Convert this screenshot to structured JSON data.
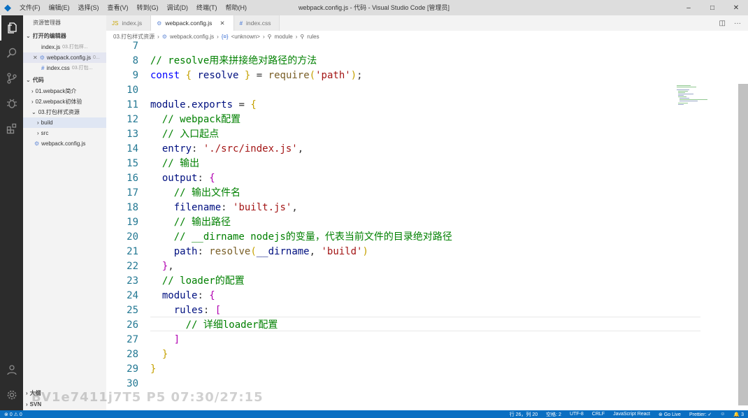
{
  "window": {
    "title": "webpack.config.js - 代码 - Visual Studio Code [管理员]",
    "menu": [
      "文件(F)",
      "编辑(E)",
      "选择(S)",
      "查看(V)",
      "转到(G)",
      "调试(D)",
      "终端(T)",
      "帮助(H)"
    ]
  },
  "sidebar": {
    "title": "资源管理器",
    "open_editors_label": "打开的编辑器",
    "open_editors": [
      {
        "name": "index.js",
        "path": "03.打包样..."
      },
      {
        "name": "webpack.config.js",
        "path": "0..."
      },
      {
        "name": "index.css",
        "path": "03.打包..."
      }
    ],
    "folder_label": "代码",
    "tree": [
      {
        "name": "01.webpack简介",
        "kind": "folder"
      },
      {
        "name": "02.webpack初体验",
        "kind": "folder"
      },
      {
        "name": "03.打包样式资源",
        "kind": "folder-open"
      },
      {
        "name": "build",
        "kind": "folder"
      },
      {
        "name": "src",
        "kind": "folder"
      },
      {
        "name": "webpack.config.js",
        "kind": "file"
      }
    ],
    "outline_label": "大纲",
    "svn_label": "SVN"
  },
  "tabs": [
    {
      "label": "index.js",
      "icon": "JS",
      "active": false
    },
    {
      "label": "webpack.config.js",
      "icon": "gear",
      "active": true
    },
    {
      "label": "index.css",
      "icon": "#",
      "active": false
    }
  ],
  "breadcrumb": [
    "03.打包样式资源",
    "webpack.config.js",
    "<unknown>",
    "module",
    "rules"
  ],
  "editor": {
    "lines": [
      {
        "n": "7",
        "t": ""
      },
      {
        "n": "8",
        "t": "// resolve用来拼接绝对路径的方法"
      },
      {
        "n": "9",
        "t": "const { resolve } = require('path');"
      },
      {
        "n": "10",
        "t": ""
      },
      {
        "n": "11",
        "t": "module.exports = {"
      },
      {
        "n": "12",
        "t": "  // webpack配置"
      },
      {
        "n": "13",
        "t": "  // 入口起点"
      },
      {
        "n": "14",
        "t": "  entry: './src/index.js',"
      },
      {
        "n": "15",
        "t": "  // 输出"
      },
      {
        "n": "16",
        "t": "  output: {"
      },
      {
        "n": "17",
        "t": "    // 输出文件名"
      },
      {
        "n": "18",
        "t": "    filename: 'built.js',"
      },
      {
        "n": "19",
        "t": "    // 输出路径"
      },
      {
        "n": "20",
        "t": "    // __dirname nodejs的变量，代表当前文件的目录绝对路径"
      },
      {
        "n": "21",
        "t": "    path: resolve(__dirname, 'build')"
      },
      {
        "n": "22",
        "t": "  },"
      },
      {
        "n": "23",
        "t": "  // loader的配置"
      },
      {
        "n": "24",
        "t": "  module: {"
      },
      {
        "n": "25",
        "t": "    rules: ["
      },
      {
        "n": "26",
        "t": "      // 详细loader配置"
      },
      {
        "n": "27",
        "t": "    ]"
      },
      {
        "n": "28",
        "t": "  }"
      },
      {
        "n": "29",
        "t": "}"
      },
      {
        "n": "30",
        "t": ""
      }
    ]
  },
  "watermark": "BV1e7411j7T5 P5 07:30/27:15",
  "status": {
    "errors": "0",
    "warnings": "0",
    "position": "行 26，列 20",
    "spaces": "空格: 2",
    "encoding": "UTF-8",
    "eol": "CRLF",
    "language": "JavaScript React",
    "golive": "Go Live",
    "prettier": "Prettier: ✓",
    "notifications": "3"
  }
}
